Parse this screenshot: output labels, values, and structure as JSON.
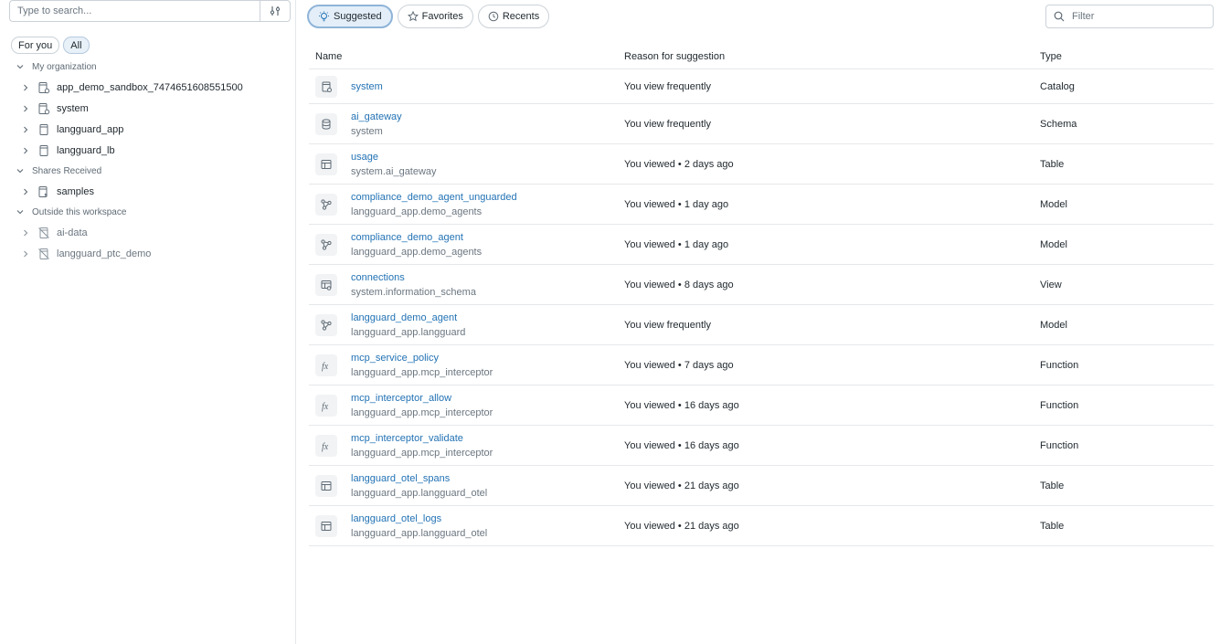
{
  "sidebar": {
    "search_placeholder": "Type to search...",
    "pills": [
      {
        "label": "For you"
      },
      {
        "label": "All"
      }
    ],
    "sections": [
      {
        "label": "My organization",
        "items": [
          {
            "label": "app_demo_sandbox_7474651608551500",
            "icon": "catalog-gear-icon"
          },
          {
            "label": "system",
            "icon": "catalog-gear-icon"
          },
          {
            "label": "langguard_app",
            "icon": "catalog-icon"
          },
          {
            "label": "langguard_lb",
            "icon": "catalog-icon"
          }
        ]
      },
      {
        "label": "Shares Received",
        "items": [
          {
            "label": "samples",
            "icon": "shared-catalog-icon"
          }
        ]
      },
      {
        "label": "Outside this workspace",
        "items": [
          {
            "label": "ai-data",
            "icon": "catalog-unavailable-icon"
          },
          {
            "label": "langguard_ptc_demo",
            "icon": "catalog-unavailable-icon"
          }
        ]
      }
    ]
  },
  "main": {
    "tabs": [
      {
        "label": "Suggested",
        "icon": "lightbulb-icon",
        "active": true
      },
      {
        "label": "Favorites",
        "icon": "star-icon"
      },
      {
        "label": "Recents",
        "icon": "clock-icon"
      }
    ],
    "filter_placeholder": "Filter",
    "columns": {
      "name": "Name",
      "reason": "Reason for suggestion",
      "type": "Type"
    },
    "rows": [
      {
        "name": "system",
        "sub": "",
        "reason": "You view frequently",
        "type": "Catalog",
        "icon": "catalog-gear-icon"
      },
      {
        "name": "ai_gateway",
        "sub": "system",
        "reason": "You view frequently",
        "type": "Schema",
        "icon": "database-icon"
      },
      {
        "name": "usage",
        "sub": "system.ai_gateway",
        "reason": "You viewed • 2 days ago",
        "type": "Table",
        "icon": "table-icon"
      },
      {
        "name": "compliance_demo_agent_unguarded",
        "sub": "langguard_app.demo_agents",
        "reason": "You viewed • 1 day ago",
        "type": "Model",
        "icon": "model-icon"
      },
      {
        "name": "compliance_demo_agent",
        "sub": "langguard_app.demo_agents",
        "reason": "You viewed • 1 day ago",
        "type": "Model",
        "icon": "model-icon"
      },
      {
        "name": "connections",
        "sub": "system.information_schema",
        "reason": "You viewed • 8 days ago",
        "type": "View",
        "icon": "view-icon"
      },
      {
        "name": "langguard_demo_agent",
        "sub": "langguard_app.langguard",
        "reason": "You view frequently",
        "type": "Model",
        "icon": "model-icon"
      },
      {
        "name": "mcp_service_policy",
        "sub": "langguard_app.mcp_interceptor",
        "reason": "You viewed • 7 days ago",
        "type": "Function",
        "icon": "function-icon"
      },
      {
        "name": "mcp_interceptor_allow",
        "sub": "langguard_app.mcp_interceptor",
        "reason": "You viewed • 16 days ago",
        "type": "Function",
        "icon": "function-icon"
      },
      {
        "name": "mcp_interceptor_validate",
        "sub": "langguard_app.mcp_interceptor",
        "reason": "You viewed • 16 days ago",
        "type": "Function",
        "icon": "function-icon"
      },
      {
        "name": "langguard_otel_spans",
        "sub": "langguard_app.langguard_otel",
        "reason": "You viewed • 21 days ago",
        "type": "Table",
        "icon": "table-icon"
      },
      {
        "name": "langguard_otel_logs",
        "sub": "langguard_app.langguard_otel",
        "reason": "You viewed • 21 days ago",
        "type": "Table",
        "icon": "table-icon"
      }
    ]
  }
}
